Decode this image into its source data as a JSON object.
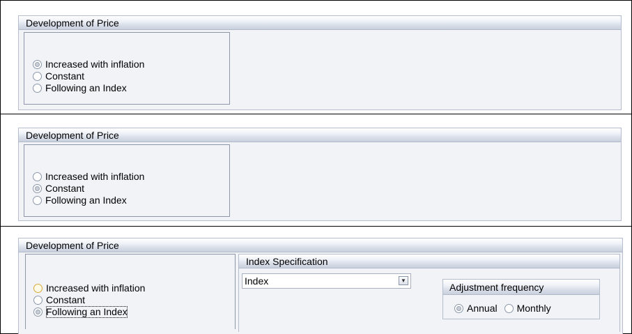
{
  "screens": [
    {
      "group_title": "Development of Price",
      "options": [
        "Increased with inflation",
        "Constant",
        "Following an Index"
      ],
      "selected": "Increased with inflation"
    },
    {
      "group_title": "Development of Price",
      "options": [
        "Increased with inflation",
        "Constant",
        "Following an Index"
      ],
      "selected": "Constant"
    },
    {
      "group_title": "Development of Price",
      "options": [
        "Increased with inflation",
        "Constant",
        "Following an Index"
      ],
      "selected": "Following an Index",
      "index_spec": {
        "title": "Index Specification",
        "select_value": "Index",
        "adjustment": {
          "title": "Adjustment frequency",
          "options": [
            "Annual",
            "Monthly"
          ],
          "selected": "Annual"
        }
      }
    }
  ]
}
